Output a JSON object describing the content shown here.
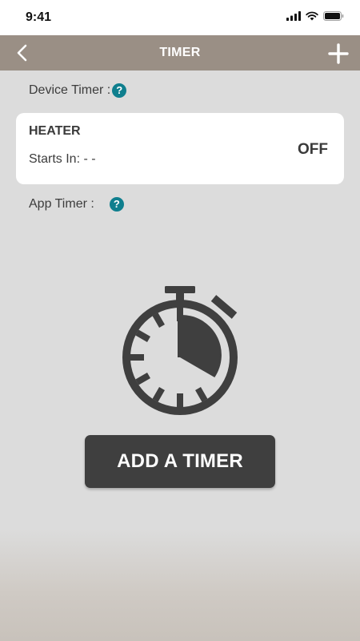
{
  "status_bar": {
    "time": "9:41"
  },
  "header": {
    "title": "TIMER"
  },
  "device_timer": {
    "label": "Device Timer :",
    "help_glyph": "?",
    "card": {
      "name": "HEATER",
      "starts_label": "Starts In: - -",
      "state": "OFF"
    }
  },
  "app_timer": {
    "label": "App Timer :",
    "help_glyph": "?"
  },
  "add_timer": {
    "label": "ADD A TIMER"
  },
  "colors": {
    "header_bg": "#9a8f85",
    "accent": "#0f7f8e",
    "button_bg": "#3f3f3f"
  },
  "icons": [
    "back-chevron-icon",
    "plus-icon",
    "help-icon",
    "stopwatch-icon",
    "signal-icon",
    "wifi-icon",
    "battery-icon"
  ]
}
